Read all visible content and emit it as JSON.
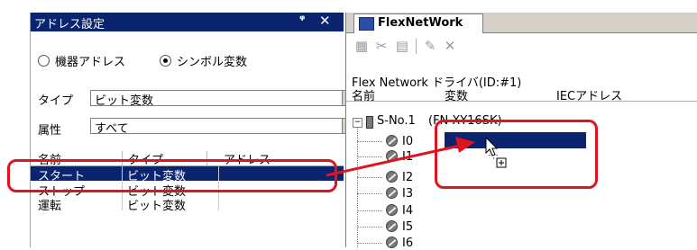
{
  "left_panel": {
    "title": "アドレス設定",
    "pin_icon": "pin-icon",
    "close_icon": "close-icon",
    "radio_device_address": "機器アドレス",
    "radio_symbol_variable": "シンボル変数",
    "radio_selected": "シンボル変数",
    "type_label": "タイプ",
    "type_value": "ビット変数",
    "attribute_label": "属性",
    "attribute_value": "すべて",
    "columns": [
      "名前",
      "タイプ",
      "アドレス"
    ],
    "rows": [
      {
        "name": "スタート",
        "type": "ビット変数",
        "selected": true
      },
      {
        "name": "ストップ",
        "type": "ビット変数",
        "selected": false
      },
      {
        "name": "運転",
        "type": "ビット変数",
        "selected": false
      }
    ]
  },
  "right_panel": {
    "tab_label": "FlexNetWork",
    "toolbar_icons": [
      "paste-icon",
      "cut-icon",
      "copy-icon",
      "properties-icon",
      "delete-icon"
    ],
    "driver_title": "Flex Network ドライバ(ID:#1)",
    "columns": [
      "名前",
      "変数",
      "IECアドレス"
    ],
    "node_label": "S-No.1",
    "node_type": "(FN-XY16SK)",
    "io_items": [
      "I0",
      "I1",
      "I2",
      "I3",
      "I4",
      "I5",
      "I6"
    ]
  },
  "colors": {
    "selection": "#0a2470",
    "highlight": "#e0141e"
  }
}
